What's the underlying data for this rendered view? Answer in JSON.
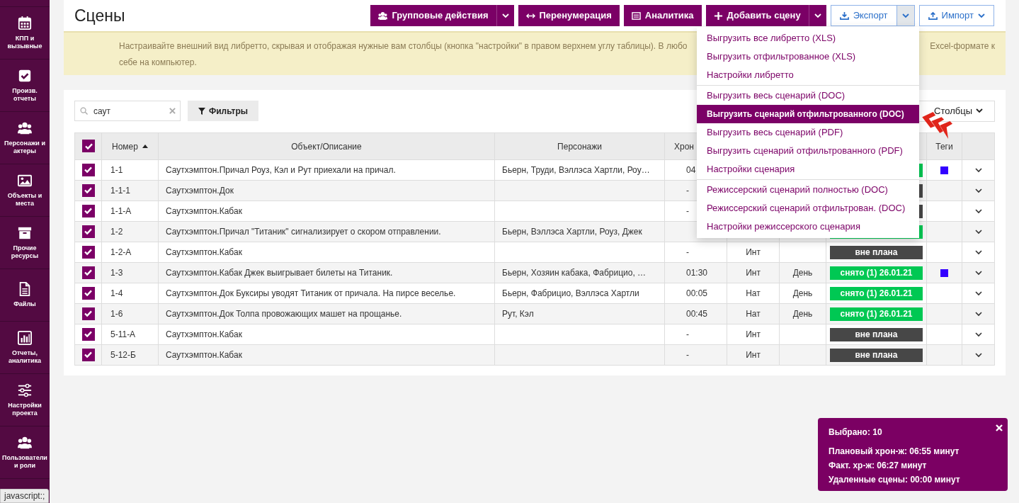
{
  "sidebar": {
    "items": [
      {
        "label": "КПП и вызывные"
      },
      {
        "label": "Произв. отчеты"
      },
      {
        "label": "Персонажи и актеры"
      },
      {
        "label": "Объекты и места"
      },
      {
        "label": "Прочие ресурсы"
      },
      {
        "label": "Файлы"
      },
      {
        "label": "Отчеты, аналитика"
      },
      {
        "label": "Настройки проекта"
      },
      {
        "label": "Пользователи и роли"
      }
    ]
  },
  "header": {
    "title": "Сцены",
    "toolbar": [
      {
        "label": "Групповые действия",
        "kind": "primary-split"
      },
      {
        "label": "Перенумерация",
        "kind": "primary"
      },
      {
        "label": "Аналитика",
        "kind": "primary"
      },
      {
        "label": "Добавить сцену",
        "kind": "primary-split"
      },
      {
        "label": "Экспорт",
        "kind": "outline-split",
        "expanded": true
      },
      {
        "label": "Импорт",
        "kind": "outline-caret"
      }
    ]
  },
  "notice": {
    "line_start": "Настраивайте внешний вид либретто, скрывая и отображая нужные вам столбцы (кнопка \"настройки\" в правом верхнем углу таблицы). В любо",
    "line_end": "Excel-формате к",
    "line_2": "себе на компьютер."
  },
  "filters": {
    "search": {
      "value": "саут"
    },
    "filter_button": "Фильтры",
    "columns_button": "Столбцы"
  },
  "table": {
    "all_checked": true,
    "columns": [
      "Номер",
      "Объект/Описание",
      "Персонажи",
      "Хрон",
      "Теги"
    ],
    "sorted_ascending": true,
    "rows": [
      {
        "number": "1-1",
        "object": "Саутхэмптон.Причал Роуз, Кэл и Рут приехали на причал.",
        "characters": "Бьерн, Труди, Вэллэса Хартли, Роу…",
        "duration": "04",
        "status": {
          "kind": "shot"
        },
        "tag": {
          "color": "#3300ff"
        },
        "checked": true
      },
      {
        "number": "1-1-1",
        "object": "Саутхэмптон.Док",
        "duration": "-",
        "status": {
          "kind": "unplanned"
        },
        "checked": true
      },
      {
        "number": "1-1-А",
        "object": "Саутхэмптон.Кабак",
        "duration": "-",
        "status": {
          "kind": "unplanned"
        },
        "checked": true
      },
      {
        "number": "1-2",
        "object": "Саутхэмптон.Причал \"Титаник\" сигнализирует о скором отправлении.",
        "characters": "Бьерн, Вэллэса Хартли, Роуз, Джек",
        "status": {
          "kind": "shot"
        },
        "checked": true
      },
      {
        "number": "1-2-А",
        "object": "Саутхэмптон.Кабак",
        "duration": "-",
        "place": "Инт",
        "status": {
          "kind": "unplanned",
          "label": "вне плана"
        },
        "checked": true
      },
      {
        "number": "1-3",
        "object": "Саутхэмптон.Кабак Джек выигрывает билеты на Титаник.",
        "characters": "Бьерн, Хозяин кабака, Фабрицио, …",
        "duration": "01:30",
        "place": "Инт",
        "time": "День",
        "status": {
          "kind": "shot",
          "label": "снято (1) 26.01.21"
        },
        "tag": {
          "color": "#3300ff"
        },
        "checked": true
      },
      {
        "number": "1-4",
        "object": "Саутхэмптон.Док Буксиры уводят Титаник от причала. На пирсе веселье.",
        "characters": "Бьерн, Фабрицио, Вэллэса Хартли",
        "duration": "00:05",
        "place": "Нат",
        "time": "День",
        "status": {
          "kind": "shot",
          "label": "снято (1) 26.01.21"
        },
        "checked": true
      },
      {
        "number": "1-6",
        "object": "Саутхэмптон.Док Толпа провожающих машет на прощанье.",
        "characters": "Рут, Кэл",
        "duration": "00:45",
        "place": "Нат",
        "time": "День",
        "status": {
          "kind": "shot",
          "label": "снято (1) 26.01.21"
        },
        "checked": true
      },
      {
        "number": "5-11-А",
        "object": "Саутхэмптон.Кабак",
        "duration": "-",
        "place": "Инт",
        "status": {
          "kind": "unplanned",
          "label": "вне плана"
        },
        "checked": true
      },
      {
        "number": "5-12-Б",
        "object": "Саутхэмптон.Кабак",
        "duration": "-",
        "place": "Инт",
        "status": {
          "kind": "unplanned",
          "label": "вне плана"
        },
        "checked": true
      }
    ]
  },
  "export_menu": {
    "groups": [
      {
        "items": [
          {
            "label": "Выгрузить все либретто (XLS)",
            "selected": false
          },
          {
            "label": "Выгрузить отфильтрованное (XLS)",
            "selected": false
          },
          {
            "label": "Настройки либретто",
            "selected": false
          }
        ]
      },
      {
        "items": [
          {
            "label": "Выгрузить весь сценарий (DOC)",
            "selected": false
          },
          {
            "label": "Выгрузить сценарий отфильтрованного (DOC)",
            "selected": true
          },
          {
            "label": "Выгрузить весь сценарий (PDF)",
            "selected": false
          },
          {
            "label": "Выгрузить сценарий отфильтрованного (PDF)",
            "selected": false
          },
          {
            "label": "Настройки сценария",
            "selected": false
          }
        ]
      },
      {
        "items": [
          {
            "label": "Режиссерский сценарий полностью (DOC)",
            "selected": false
          },
          {
            "label": "Режиссерский сценарий отфильтрован. (DOC)",
            "selected": false
          },
          {
            "label": "Настройки режиссерского сценария",
            "selected": false
          }
        ]
      }
    ]
  },
  "summary": {
    "lines": [
      "Выбрано: 10",
      "Плановый хрон-ж: 06:55 минут",
      "Факт. хр-ж: 06:27 минут",
      "Удаленные сцены: 00:00 минут"
    ]
  },
  "status_bar": {
    "text": "javascript:;"
  }
}
